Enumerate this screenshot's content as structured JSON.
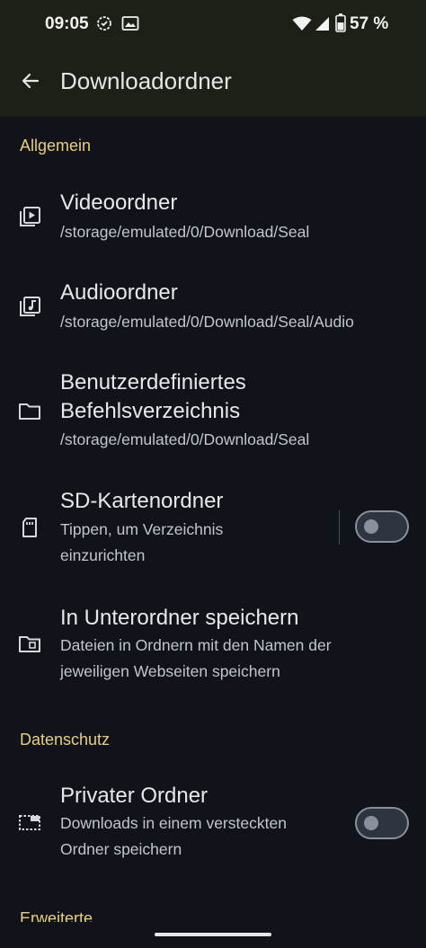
{
  "status_bar": {
    "time": "09:05",
    "battery_percent": "57 %"
  },
  "topbar": {
    "title": "Downloadordner",
    "back_icon": "arrow-back-icon"
  },
  "sections": {
    "general": "Allgemein",
    "privacy": "Datenschutz",
    "advanced": "Erweiterte"
  },
  "items": {
    "video": {
      "title": "Videoordner",
      "subtitle": "/storage/emulated/0/Download/Seal",
      "icon": "video-library-icon"
    },
    "audio": {
      "title": "Audioordner",
      "subtitle": "/storage/emulated/0/Download/Seal/Audio",
      "icon": "music-library-icon"
    },
    "custom_cmd": {
      "title_line1": "Benutzerdefiniertes",
      "title_line2": "Befehlsverzeichnis",
      "subtitle": "/storage/emulated/0/Download/Seal",
      "icon": "folder-icon"
    },
    "sd_card": {
      "title": "SD-Kartenordner",
      "subtitle_line1": "Tippen, um Verzeichnis",
      "subtitle_line2": "einzurichten",
      "icon": "sd-card-icon",
      "enabled": false
    },
    "subfolder": {
      "title": "In Unterordner speichern",
      "subtitle_line1": "Dateien in Ordnern mit den Namen der",
      "subtitle_line2": "jeweiligen Webseiten speichern",
      "icon": "folder-data-icon"
    },
    "private": {
      "title": "Privater Ordner",
      "subtitle_line1": "Downloads in einem versteckten",
      "subtitle_line2": "Ordner speichern",
      "icon": "hidden-folder-icon",
      "enabled": false
    }
  },
  "colors": {
    "background": "#10141a",
    "topbar": "#1c2017",
    "accent": "#e9cf79"
  }
}
